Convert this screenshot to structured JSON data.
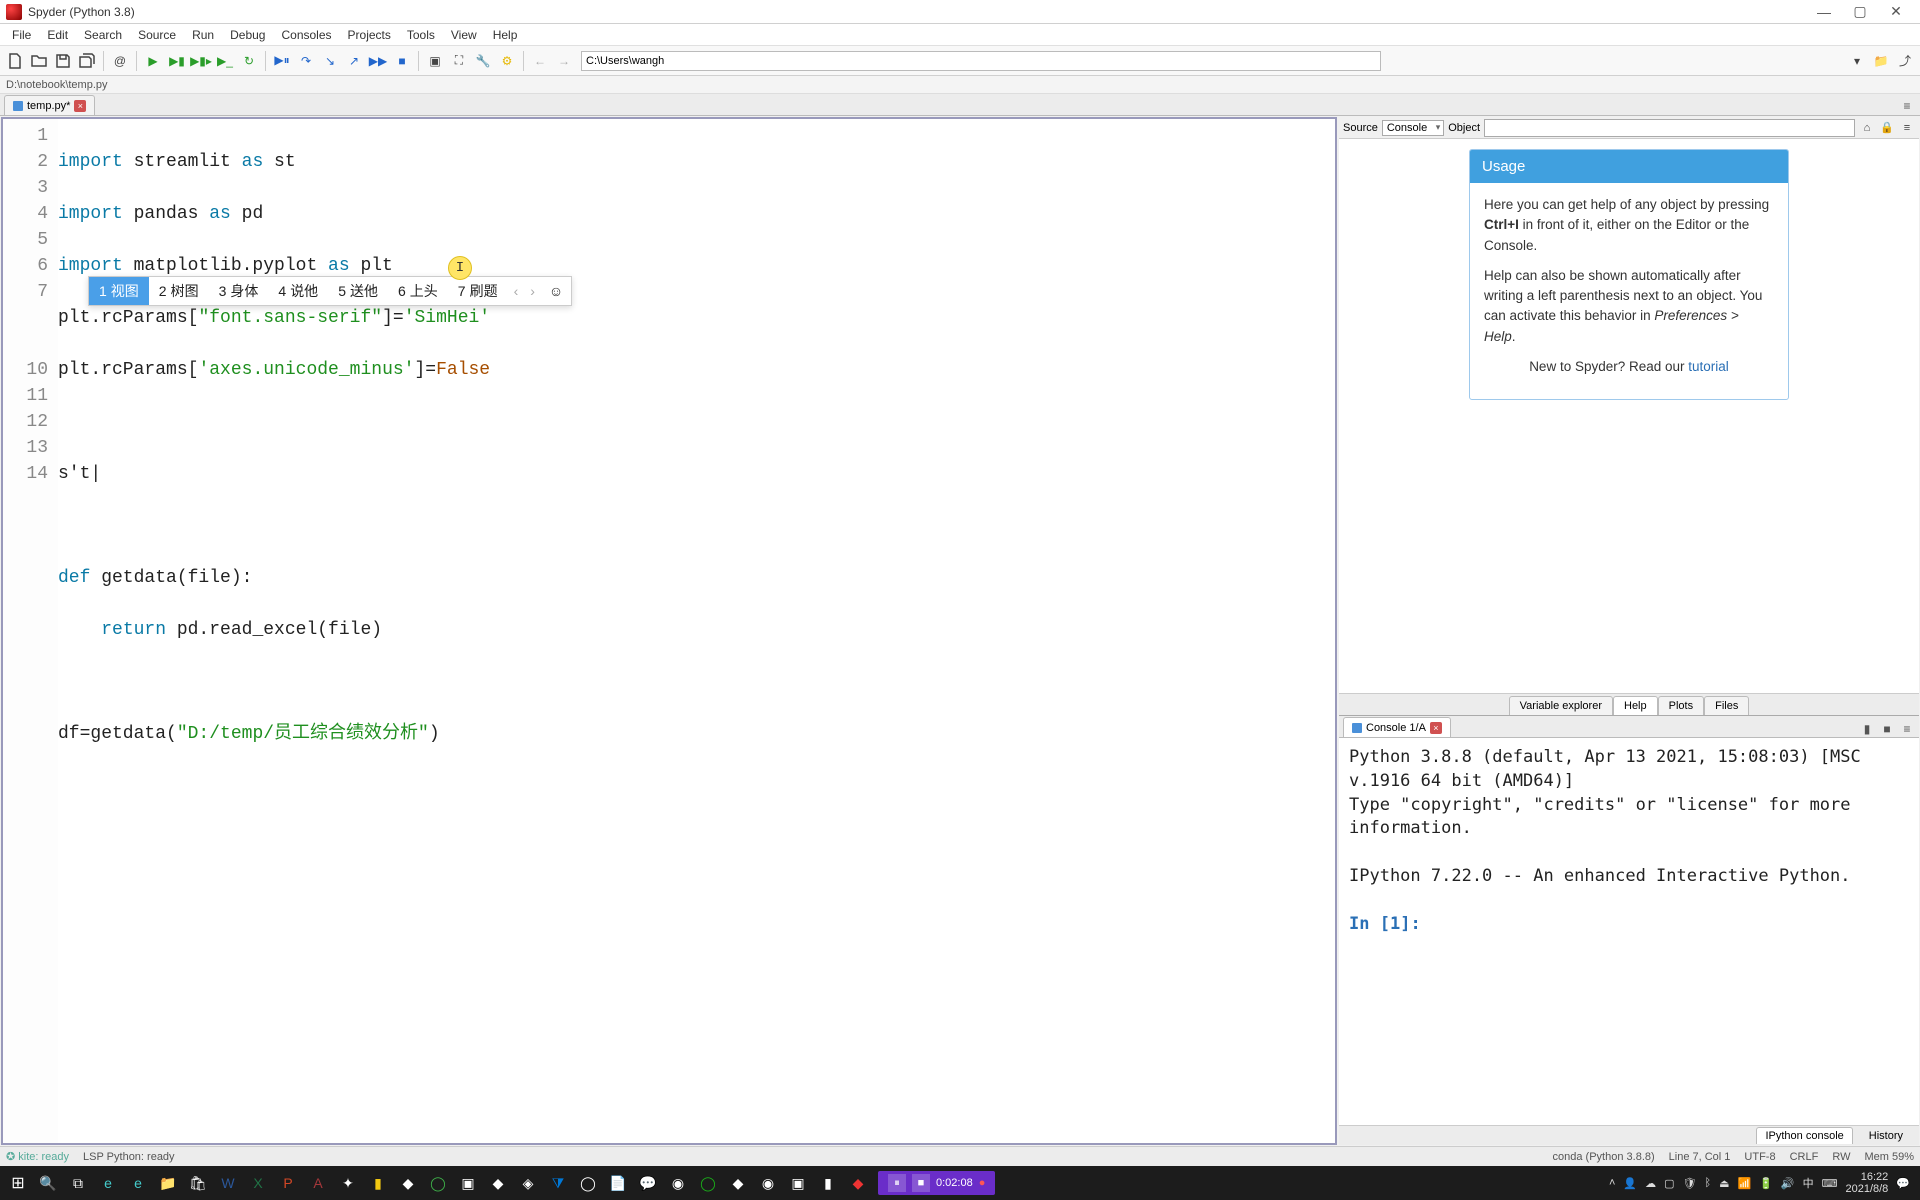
{
  "window": {
    "title": "Spyder (Python 3.8)"
  },
  "menu": [
    "File",
    "Edit",
    "Search",
    "Source",
    "Run",
    "Debug",
    "Consoles",
    "Projects",
    "Tools",
    "View",
    "Help"
  ],
  "toolbar": {
    "path_value": "C:\\Users\\wangh"
  },
  "breadcrumb": "D:\\notebook\\temp.py",
  "editor_tab": {
    "name": "temp.py*",
    "close": "×"
  },
  "gutter_lines": [
    "1",
    "2",
    "3",
    "4",
    "5",
    "6",
    "7",
    "",
    "",
    "10",
    "11",
    "12",
    "13",
    "14"
  ],
  "code": {
    "l1a": "import",
    "l1b": " streamlit ",
    "l1c": "as",
    "l1d": " st",
    "l2a": "import",
    "l2b": " pandas ",
    "l2c": "as",
    "l2d": " pd",
    "l3a": "import",
    "l3b": " matplotlib.pyplot ",
    "l3c": "as",
    "l3d": " plt",
    "l4a": "plt.rcParams[",
    "l4b": "\"font.sans-serif\"",
    "l4c": "]=",
    "l4d": "'SimHei'",
    "l5a": "plt.rcParams[",
    "l5b": "'axes.unicode_minus'",
    "l5c": "]=",
    "l5d": "False",
    "l7": "s't|",
    "l9a": "def",
    "l9b": " getdata(file):",
    "l10a": "    ",
    "l10b": "return",
    "l10c": " pd.read_excel(file)",
    "l12a": "df=getdata(",
    "l12b": "\"D:/temp/员工综合绩效分析\"",
    "l12c": ")"
  },
  "ime": {
    "items": [
      {
        "n": "1",
        "t": "视图"
      },
      {
        "n": "2",
        "t": "树图"
      },
      {
        "n": "3",
        "t": "身体"
      },
      {
        "n": "4",
        "t": "说他"
      },
      {
        "n": "5",
        "t": "送他"
      },
      {
        "n": "6",
        "t": "上头"
      },
      {
        "n": "7",
        "t": "刷题"
      }
    ],
    "prev": "‹",
    "next": "›",
    "smile": "☺"
  },
  "cursor_glyph": "I",
  "help": {
    "source_label": "Source",
    "source_value": "Console",
    "object_label": "Object",
    "object_value": "",
    "usage_title": "Usage",
    "p1a": "Here you can get help of any object by pressing ",
    "p1b": "Ctrl+I",
    "p1c": " in front of it, either on the Editor or the Console.",
    "p2a": "Help can also be shown automatically after writing a left parenthesis next to an object. You can activate this behavior in ",
    "p2b": "Preferences > Help",
    "p2c": ".",
    "tut_a": "New to Spyder? Read our ",
    "tut_b": "tutorial"
  },
  "right_tabs": [
    "Variable explorer",
    "Help",
    "Plots",
    "Files"
  ],
  "console_tab": {
    "label": "Console 1/A",
    "close": "×"
  },
  "console_text": {
    "line1": "Python 3.8.8 (default, Apr 13 2021, 15:08:03) [MSC v.1916 64 bit (AMD64)]",
    "line2": "Type \"copyright\", \"credits\" or \"license\" for more information.",
    "line3": "",
    "line4": "IPython 7.22.0 -- An enhanced Interactive Python.",
    "prompt_in": "In [",
    "prompt_n": "1",
    "prompt_end": "]: "
  },
  "console_bottom_tabs": [
    "IPython console",
    "History"
  ],
  "status": {
    "kite": "✪ kite: ready",
    "lsp": "LSP Python: ready",
    "conda": "conda (Python 3.8.8)",
    "pos": "Line 7, Col 1",
    "enc": "UTF-8",
    "eol": "CRLF",
    "rw": "RW",
    "mem": "Mem 59%"
  },
  "recorder": {
    "pause": "⏸",
    "stop": "■",
    "time": "0:02:08",
    "rec": "●"
  },
  "clock": {
    "time": "16:22",
    "date": "2021/8/8"
  }
}
